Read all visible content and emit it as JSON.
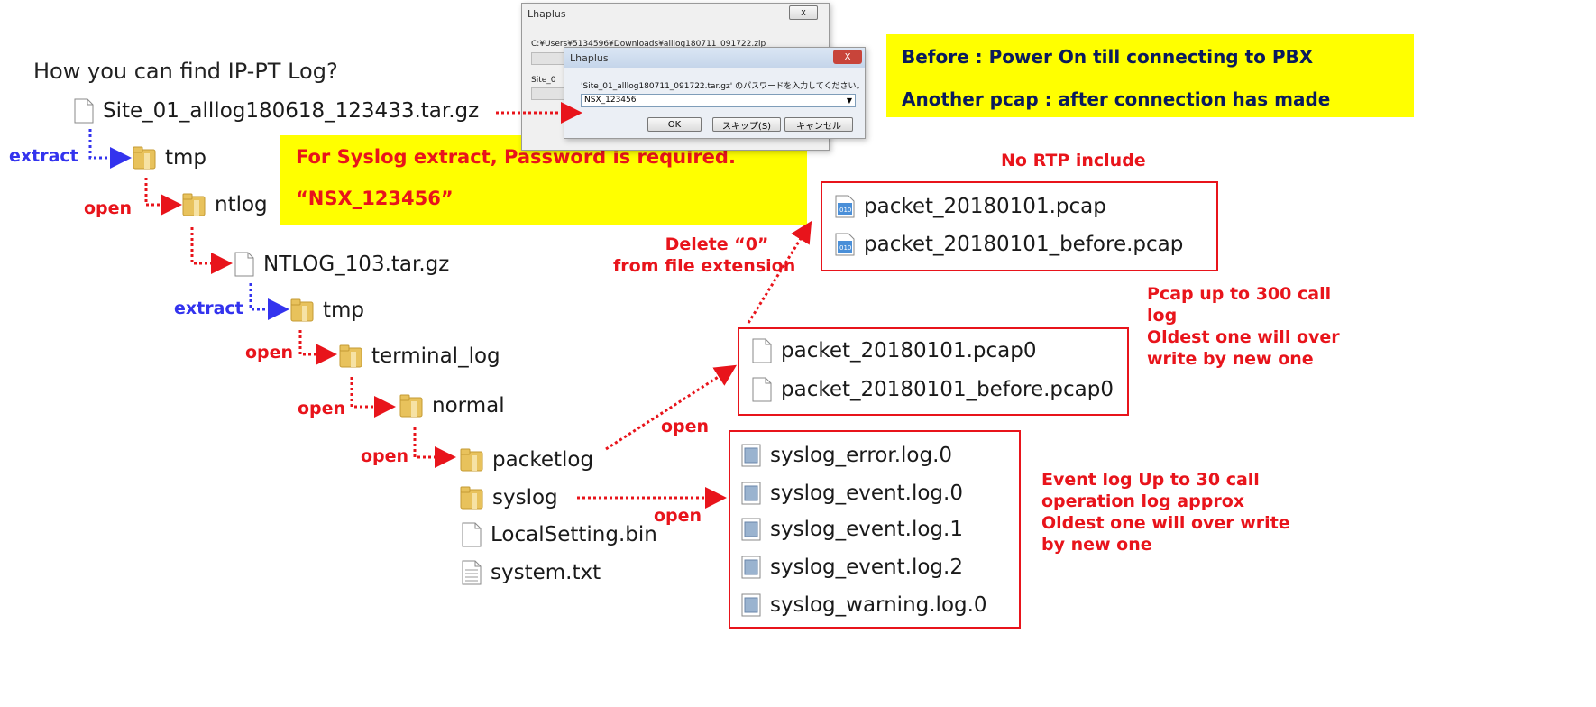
{
  "title": "How you can find IP-PT Log?",
  "tree": [
    {
      "label": "Site_01_alllog180618_123433.tar.gz",
      "icon": "file-icon"
    },
    {
      "label": "tmp",
      "icon": "folder-icon"
    },
    {
      "label": "ntlog",
      "icon": "folder-icon"
    },
    {
      "label": "NTLOG_103.tar.gz",
      "icon": "file-icon"
    },
    {
      "label": "tmp",
      "icon": "folder-icon"
    },
    {
      "label": "terminal_log",
      "icon": "folder-icon"
    },
    {
      "label": "normal",
      "icon": "folder-icon"
    },
    {
      "label": "packetlog",
      "icon": "folder-icon"
    },
    {
      "label": "syslog",
      "icon": "folder-icon"
    },
    {
      "label": "LocalSetting.bin",
      "icon": "file-icon"
    },
    {
      "label": "system.txt",
      "icon": "text-file-icon"
    }
  ],
  "step_labels": {
    "extract_1": "extract",
    "open_1": "open",
    "extract_2": "extract",
    "open_2": "open",
    "open_3": "open",
    "open_4": "open",
    "open_packet": "open",
    "open_syslog": "open"
  },
  "password_box": {
    "line1": "For Syslog extract,  Password is required.",
    "line2": "“NSX_123456”"
  },
  "pcap_box": {
    "line1": "Before  : Power On till connecting to PBX",
    "line2": "Another pcap : after connection has made"
  },
  "dialog": {
    "outer_title": "Lhaplus",
    "outer_path": "C:¥Users¥5134596¥Downloads¥alllog180711_091722.zip",
    "outer_site": "Site_0",
    "inner_title": "Lhaplus",
    "prompt": "'Site_01_alllog180711_091722.tar.gz' のパスワードを入力してください。",
    "password_value": "NSX_123456",
    "ok": "OK",
    "skip": "スキップ(S)",
    "cancel": "キャンセル",
    "close": "X"
  },
  "no_rtp_note": "No RTP include",
  "delete_note": {
    "line1": "Delete “0”",
    "line2": "from file extension"
  },
  "pcap_files": [
    "packet_20180101.pcap",
    "packet_20180101_before.pcap"
  ],
  "pcap0_files": [
    "packet_20180101.pcap0",
    "packet_20180101_before.pcap0"
  ],
  "pcap_note": [
    "Pcap up to 300 call",
    "log",
    "Oldest one will over",
    "write by new one"
  ],
  "syslog_files": [
    "syslog_error.log.0",
    "syslog_event.log.0",
    "syslog_event.log.1",
    "syslog_event.log.2",
    "syslog_warning.log.0"
  ],
  "syslog_note": [
    "Event log Up to 30 call",
    "operation log approx",
    "Oldest one will over write",
    "by new one"
  ],
  "colors": {
    "arrow_red": "#e8141b",
    "arrow_blue": "#3333ee",
    "highlight": "#ffff00"
  }
}
